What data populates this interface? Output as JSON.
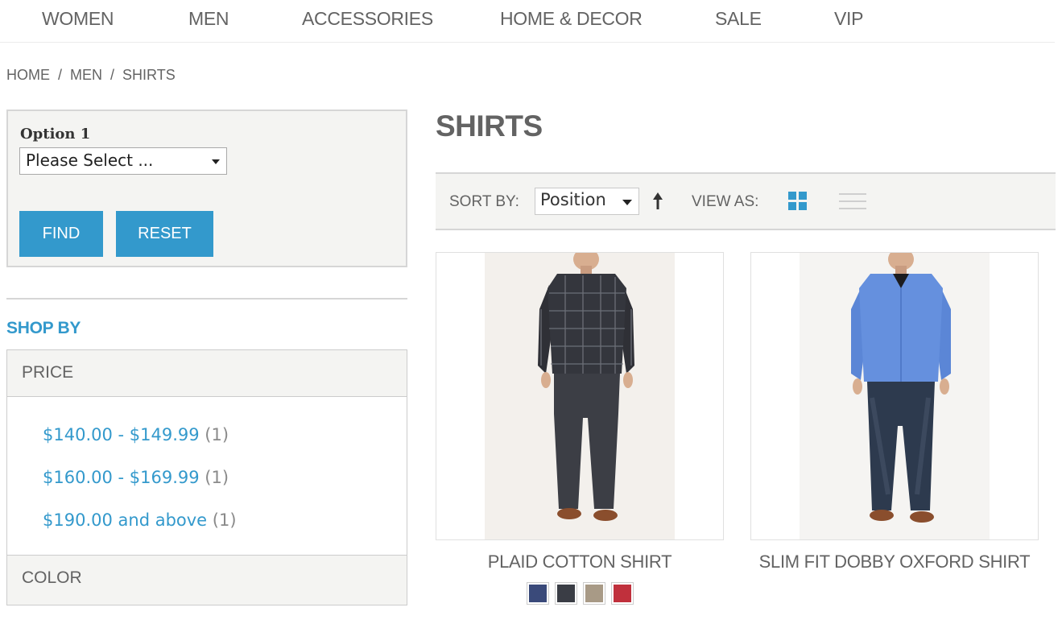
{
  "nav": [
    {
      "label": "WOMEN"
    },
    {
      "label": "MEN"
    },
    {
      "label": "ACCESSORIES"
    },
    {
      "label": "HOME & DECOR"
    },
    {
      "label": "SALE"
    },
    {
      "label": "VIP"
    }
  ],
  "breadcrumb": [
    "HOME",
    "MEN",
    "SHIRTS"
  ],
  "breadcrumb_separator": "/",
  "finder": {
    "label": "Option 1",
    "select_value": "Please Select ...",
    "find_label": "FIND",
    "reset_label": "RESET"
  },
  "shop_by": "SHOP BY",
  "filters": {
    "price_title": "PRICE",
    "price_options": [
      {
        "label": "$140.00 - $149.99",
        "count": "(1)"
      },
      {
        "label": "$160.00 - $169.99",
        "count": "(1)"
      },
      {
        "label": "$190.00 and above",
        "count": "(1)"
      }
    ],
    "color_title": "COLOR"
  },
  "main": {
    "title": "SHIRTS",
    "sort_label": "SORT BY:",
    "sort_value": "Position",
    "view_label": "VIEW AS:",
    "view_mode": "grid"
  },
  "products": [
    {
      "name": "PLAID COTTON SHIRT",
      "image_icon": "product-photo-plaid-shirt",
      "swatches": [
        "#3a4a7a",
        "#3a3d45",
        "#a89a86",
        "#c0303c"
      ]
    },
    {
      "name": "SLIM FIT DOBBY OXFORD SHIRT",
      "image_icon": "product-photo-oxford-shirt",
      "swatches": []
    }
  ],
  "colors": {
    "accent": "#3399cc",
    "text": "#636363",
    "panel_bg": "#f4f4f2"
  }
}
